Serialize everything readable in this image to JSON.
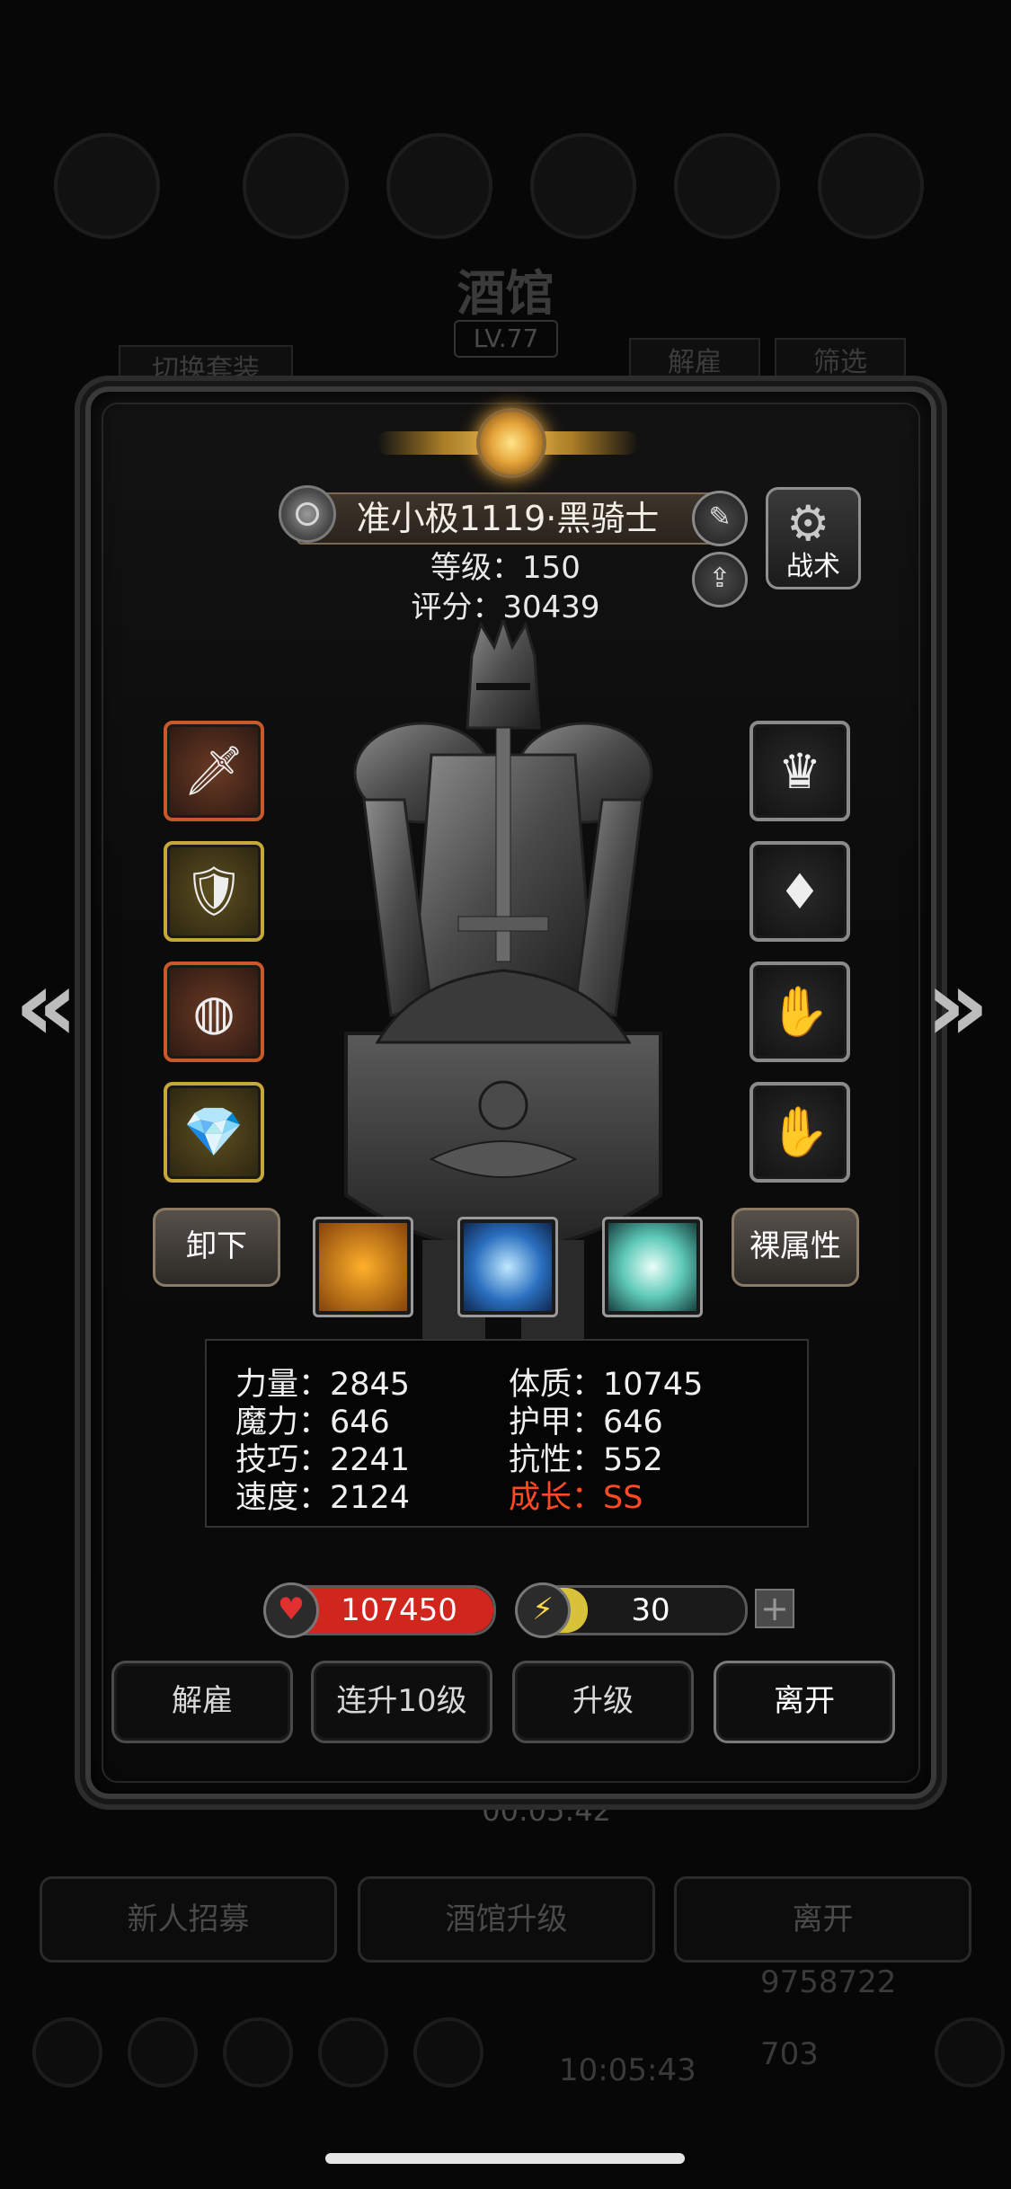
{
  "background": {
    "title": "酒馆",
    "level": "LV.77",
    "switch_set": "切换套装",
    "dismiss": "解雇",
    "filter": "筛选",
    "timer": "00:05:42",
    "bottom_buttons": [
      "新人招募",
      "酒馆升级",
      "离开"
    ],
    "gold": "9758722",
    "gems": "703",
    "clock": "10:05:43"
  },
  "hero": {
    "name": "准小极1119·黑骑士",
    "level_text": "等级：150",
    "score_text": "评分：30439",
    "tactics_label": "战术"
  },
  "equipment": {
    "left": [
      "sword",
      "chest-armor",
      "dark-ring",
      "blue-gem-amulet"
    ],
    "right": [
      "purple-helm",
      "red-gem",
      "claw-gauntlet",
      "claw-gauntlet"
    ]
  },
  "buttons": {
    "unequip": "卸下",
    "base_attr": "裸属性"
  },
  "skills": [
    "shield-skill",
    "eye-skill",
    "slash-skill"
  ],
  "attributes": {
    "strength": "力量：2845",
    "magic": "魔力：646",
    "skill": "技巧：2241",
    "speed": "速度：2124",
    "constitution": "体质：10745",
    "armor": "护甲：646",
    "resist": "抗性：552",
    "growth": "成长：SS"
  },
  "bars": {
    "hp": "107450",
    "hp_fill": 1.0,
    "energy": "30",
    "energy_fill": 0.3
  },
  "actions": {
    "dismiss": "解雇",
    "level10": "连升10级",
    "upgrade": "升级",
    "leave": "离开"
  },
  "colors": {
    "hp": "#d0261e",
    "energy": "#d8c23a",
    "growth": "#ff4a24"
  }
}
